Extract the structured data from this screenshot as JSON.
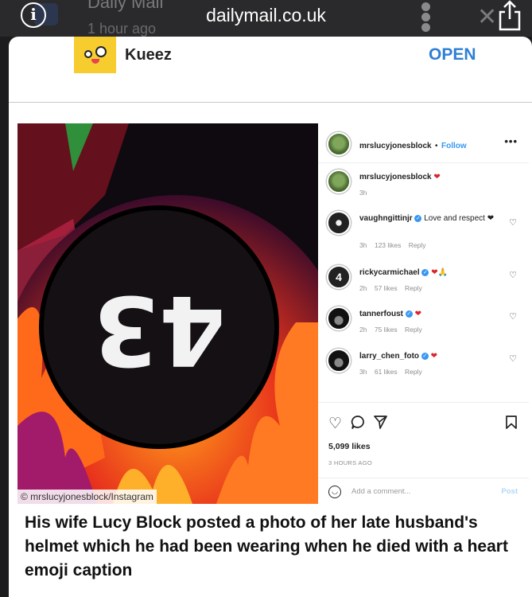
{
  "browser": {
    "domain": "dailymail.co.uk",
    "ghost_title": "Daily Mail",
    "ghost_time": "1 hour ago"
  },
  "ad": {
    "brand": "Kueez",
    "cta": "OPEN",
    "brand_color": "#f7cc2f",
    "cta_color": "#2f7fd6"
  },
  "instagram": {
    "photo_credit": "© mrslucyjonesblock/Instagram",
    "photo_text": "43",
    "header": {
      "user": "mrslucyjonesblock",
      "separator": "•",
      "follow": "Follow",
      "more": "•••"
    },
    "comments": [
      {
        "user": "mrslucyjonesblock",
        "text": "❤",
        "time": "3h",
        "likes": "",
        "reply": ""
      },
      {
        "user": "vaughngittinjr",
        "text": "Love and respect ❤",
        "time": "3h",
        "likes": "123 likes",
        "reply": "Reply"
      },
      {
        "user": "rickycarmichael",
        "text": "❤🙏",
        "time": "2h",
        "likes": "57 likes",
        "reply": "Reply"
      },
      {
        "user": "tannerfoust",
        "text": "❤",
        "time": "2h",
        "likes": "75 likes",
        "reply": "Reply"
      },
      {
        "user": "larry_chen_foto",
        "text": "❤",
        "time": "3h",
        "likes": "61 likes",
        "reply": "Reply"
      }
    ],
    "likes": "5,099 likes",
    "posted": "3 HOURS AGO",
    "add_comment_placeholder": "Add a comment...",
    "post_label": "Post",
    "accent_color": "#3897f0"
  },
  "caption": "His wife Lucy Block posted a photo of her late husband's helmet which he had been wearing when he died with a heart emoji caption"
}
